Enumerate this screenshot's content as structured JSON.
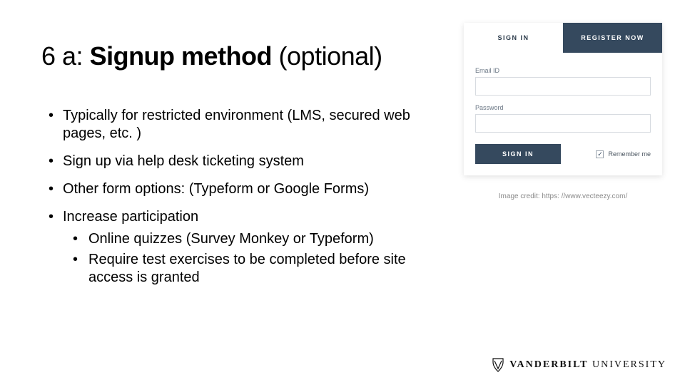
{
  "headline": {
    "prefix": "6 a: ",
    "bold": "Signup method",
    "suffix": " (optional)"
  },
  "bullets": [
    {
      "text": "Typically for restricted environment (LMS, secured web pages, etc. )"
    },
    {
      "text": "Sign up via help desk ticketing system"
    },
    {
      "text": "Other form options: (Typeform or Google Forms)"
    },
    {
      "text": "Increase participation",
      "children": [
        "Online quizzes (Survey Monkey or Typeform)",
        "Require test exercises to be completed before site access is granted"
      ]
    }
  ],
  "login": {
    "tab_signin": "SIGN IN",
    "tab_register": "REGISTER NOW",
    "email_label": "Email ID",
    "password_label": "Password",
    "signin_btn": "SIGN IN",
    "remember": "Remember me",
    "remember_checked": "✓"
  },
  "credit": "Image credit: https: //www.vecteezy.com/",
  "brand": {
    "name": "VANDERBILT",
    "univ": " UNIVERSITY"
  }
}
